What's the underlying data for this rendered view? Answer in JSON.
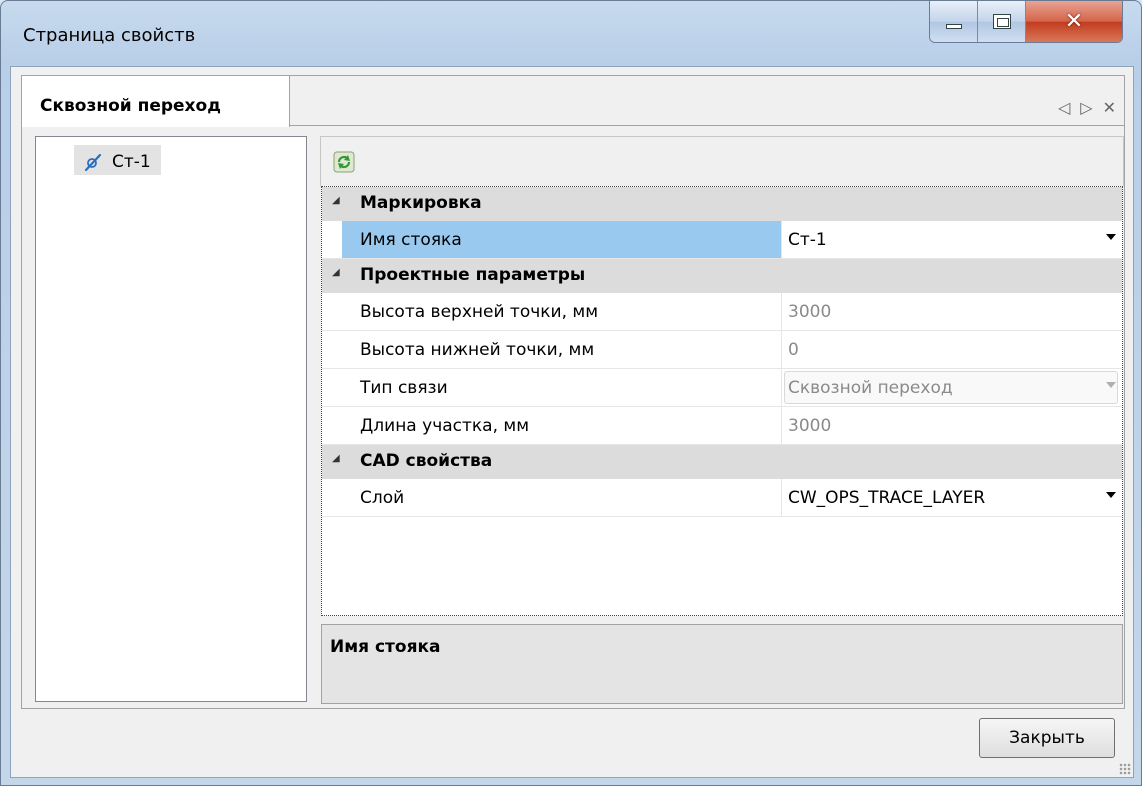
{
  "window": {
    "title": "Страница свойств",
    "controls": {
      "minimize": "minimize",
      "maximize": "maximize",
      "close": "close"
    }
  },
  "tab": {
    "label": "Сквозной переход",
    "tools": [
      "◁",
      "▷",
      "✕"
    ]
  },
  "tree": {
    "items": [
      {
        "label": "Ст-1",
        "icon": "riser-icon"
      }
    ]
  },
  "toolbar": {
    "refresh_icon": "refresh-icon"
  },
  "grid": {
    "categories": [
      {
        "label": "Маркировка",
        "rows": [
          {
            "name": "Имя стояка",
            "value": "Ст-1",
            "dropdown": true,
            "disabled": false,
            "selected": true
          }
        ]
      },
      {
        "label": "Проектные параметры",
        "rows": [
          {
            "name": "Высота верхней точки, мм",
            "value": "3000",
            "dropdown": false,
            "disabled": true
          },
          {
            "name": "Высота нижней точки, мм",
            "value": "0",
            "dropdown": false,
            "disabled": true
          },
          {
            "name": "Тип связи",
            "value": "Сквозной переход",
            "dropdown": true,
            "disabled": true
          },
          {
            "name": "Длина участка, мм",
            "value": "3000",
            "dropdown": false,
            "disabled": true
          }
        ]
      },
      {
        "label": "CAD свойства",
        "rows": [
          {
            "name": "Слой",
            "value": "CW_OPS_TRACE_LAYER",
            "dropdown": true,
            "disabled": false
          }
        ]
      }
    ]
  },
  "description": {
    "title": "Имя стояка"
  },
  "footer": {
    "close_label": "Закрыть"
  },
  "colors": {
    "selection": "#99c9ef",
    "category_bg": "#dcdcdc",
    "disabled_text": "#8a8a8a"
  }
}
